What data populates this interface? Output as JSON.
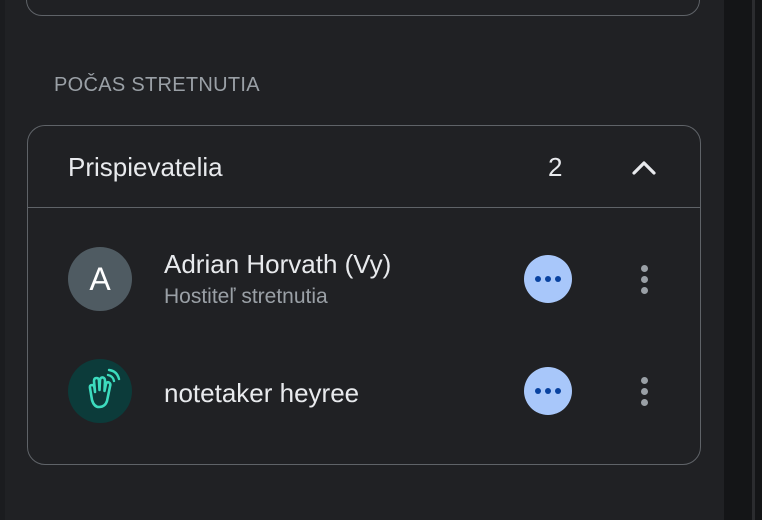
{
  "section": {
    "label": "POČAS STRETNUTIA"
  },
  "contributors": {
    "title": "Prispievatelia",
    "count": "2",
    "expanded": true,
    "people": [
      {
        "initial": "A",
        "name": "Adrian Horvath (Vy)",
        "role": "Hostiteľ stretnutia",
        "avatar_color": "#4f5b62",
        "status_icon": "more-horiz-icon"
      },
      {
        "initial": "",
        "name": "notetaker heyree",
        "role": "",
        "avatar_color": "#0c3b3a",
        "avatar_icon": "wave-hand-icon",
        "status_icon": "more-horiz-icon"
      }
    ]
  },
  "colors": {
    "accent": "#a8c7fa",
    "background": "#202124",
    "border": "#5f6368"
  }
}
